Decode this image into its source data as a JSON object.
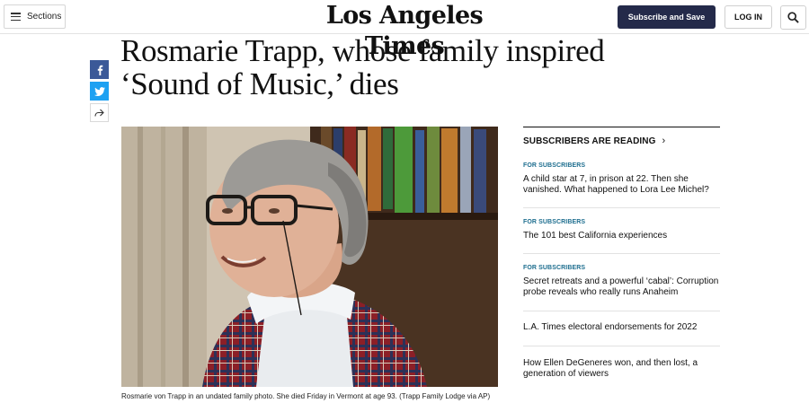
{
  "header": {
    "sections_label": "Sections",
    "logo_text": "Los Angeles Times",
    "subscribe_label": "Subscribe and Save",
    "login_label": "LOG IN"
  },
  "article": {
    "headline": "Rosmarie Trapp, whose family inspired ‘Sound of Music,’ dies",
    "caption": "Rosmarie von Trapp in an undated family photo. She died Friday in Vermont at age 93. (Trapp Family Lodge via AP)"
  },
  "sidebar": {
    "heading": "SUBSCRIBERS ARE READING",
    "items": [
      {
        "kicker": "FOR SUBSCRIBERS",
        "title": "A child star at 7, in prison at 22. Then she vanished. What happened to Lora Lee Michel?"
      },
      {
        "kicker": "FOR SUBSCRIBERS",
        "title": "The 101 best California experiences"
      },
      {
        "kicker": "FOR SUBSCRIBERS",
        "title": "Secret retreats and a powerful ‘cabal’: Corruption probe reveals who really runs Anaheim"
      },
      {
        "kicker": "",
        "title": "L.A. Times electoral endorsements for 2022"
      },
      {
        "kicker": "",
        "title": "How Ellen DeGeneres won, and then lost, a generation of viewers"
      }
    ]
  },
  "colors": {
    "subscribe_bg": "#242a4a",
    "kicker": "#1e6e8f",
    "facebook": "#3b5998",
    "twitter": "#1da1f2"
  },
  "icons": [
    "menu-icon",
    "search-icon",
    "facebook-icon",
    "twitter-icon",
    "share-icon",
    "chevron-right-icon"
  ]
}
